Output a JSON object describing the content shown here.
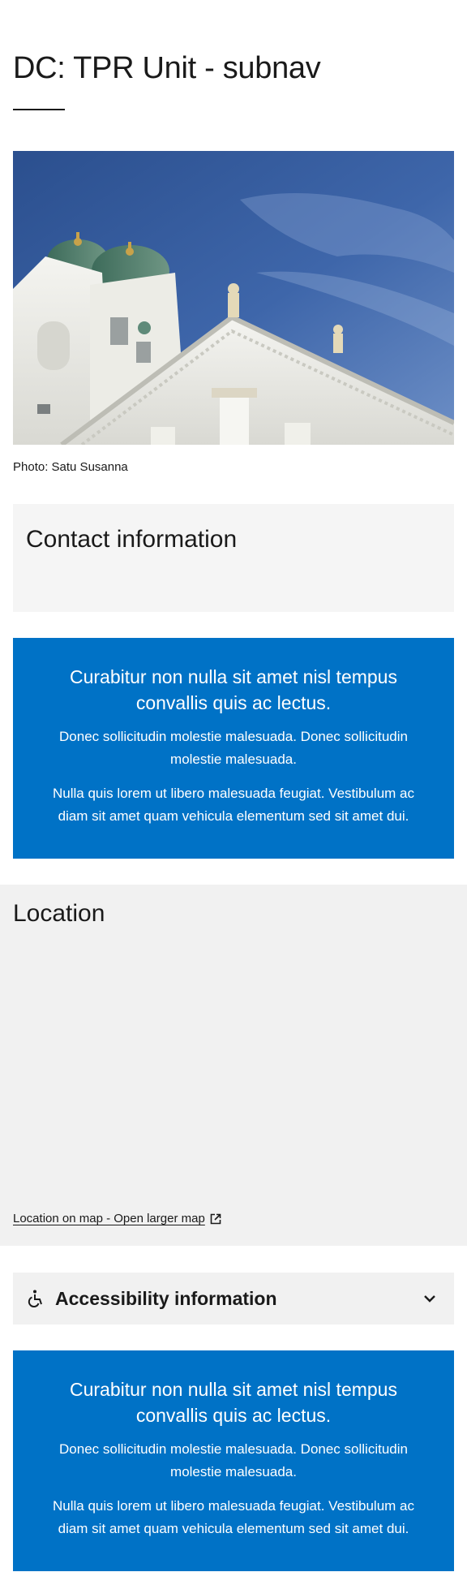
{
  "page": {
    "title": "DC: TPR Unit - subnav"
  },
  "hero": {
    "caption": "Photo: Satu Susanna"
  },
  "contact": {
    "heading": "Contact information"
  },
  "banners": [
    {
      "heading": "Curabitur non nulla sit amet nisl tempus convallis quis ac lectus.",
      "paragraph1": "Donec sollicitudin molestie malesuada. Donec sollicitudin molestie malesuada.",
      "paragraph2": "Nulla quis lorem ut libero malesuada feugiat. Vestibulum ac diam sit amet quam vehicula elementum sed sit amet dui."
    },
    {
      "heading": "Curabitur non nulla sit amet nisl tempus convallis quis ac lectus.",
      "paragraph1": "Donec sollicitudin molestie malesuada. Donec sollicitudin molestie malesuada.",
      "paragraph2": "Nulla quis lorem ut libero malesuada feugiat. Vestibulum ac diam sit amet quam vehicula elementum sed sit amet dui."
    }
  ],
  "location": {
    "heading": "Location",
    "map_link": "Location on map - Open larger map",
    "map_link_icon": "external-link-icon"
  },
  "accessibility": {
    "label": "Accessibility information",
    "icon": "wheelchair-icon",
    "toggle_icon": "chevron-down-icon"
  },
  "colors": {
    "banner_blue": "#0072c6",
    "panel_gray": "#f1f1f1",
    "text": "#1a1a1a"
  }
}
